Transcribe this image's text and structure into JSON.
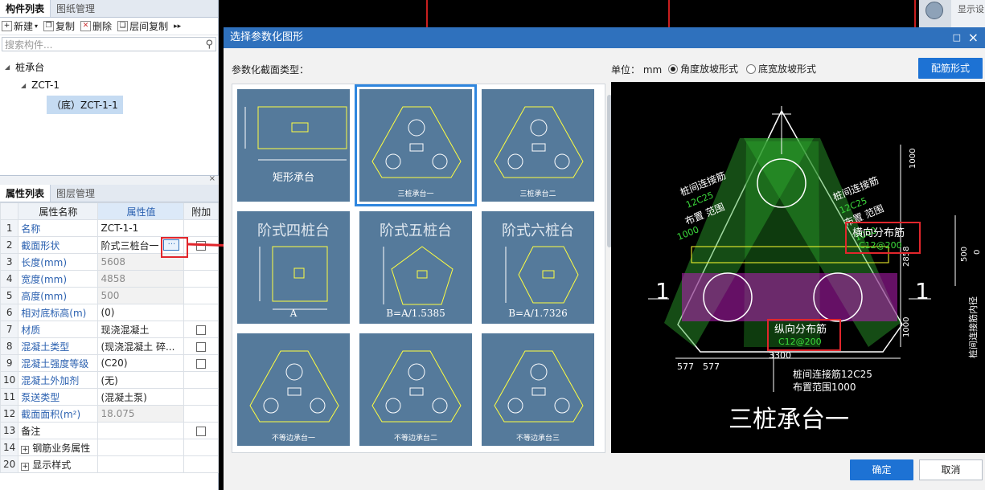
{
  "left_tabs": [
    "构件列表",
    "图纸管理"
  ],
  "toolbar": {
    "new": "新建",
    "copy": "复制",
    "delete": "删除",
    "floor_copy": "层间复制",
    "more": "▸▸"
  },
  "search_placeholder": "搜索构件...",
  "tree": {
    "root": "桩承台",
    "child": "ZCT-1",
    "leaf": "（底）ZCT-1-1"
  },
  "prop_tabs": [
    "属性列表",
    "图层管理"
  ],
  "props_header": {
    "name": "属性名称",
    "value": "属性值",
    "extra": "附加"
  },
  "props": [
    {
      "n": "1",
      "name": "名称",
      "value": "ZCT-1-1",
      "blue": true,
      "cb": false,
      "grey": false
    },
    {
      "n": "2",
      "name": "截面形状",
      "value": "阶式三桩台一",
      "blue": true,
      "cb": true,
      "grey": false
    },
    {
      "n": "3",
      "name": "长度(mm)",
      "value": "5608",
      "blue": true,
      "cb": false,
      "grey": true
    },
    {
      "n": "4",
      "name": "宽度(mm)",
      "value": "4858",
      "blue": true,
      "cb": false,
      "grey": true
    },
    {
      "n": "5",
      "name": "高度(mm)",
      "value": "500",
      "blue": true,
      "cb": false,
      "grey": true
    },
    {
      "n": "6",
      "name": "相对底标高(m)",
      "value": "(0)",
      "blue": true,
      "cb": false,
      "grey": false
    },
    {
      "n": "7",
      "name": "材质",
      "value": "现浇混凝土",
      "blue": true,
      "cb": true,
      "grey": false
    },
    {
      "n": "8",
      "name": "混凝土类型",
      "value": "(现浇混凝土  碎...",
      "blue": true,
      "cb": true,
      "grey": false
    },
    {
      "n": "9",
      "name": "混凝土强度等级",
      "value": "(C20)",
      "blue": true,
      "cb": true,
      "grey": false
    },
    {
      "n": "10",
      "name": "混凝土外加剂",
      "value": "(无)",
      "blue": true,
      "cb": false,
      "grey": false
    },
    {
      "n": "11",
      "name": "泵送类型",
      "value": "(混凝土泵)",
      "blue": true,
      "cb": false,
      "grey": false
    },
    {
      "n": "12",
      "name": "截面面积(m²)",
      "value": "18.075",
      "blue": true,
      "cb": false,
      "grey": true
    },
    {
      "n": "13",
      "name": "备注",
      "value": "",
      "blue": false,
      "cb": true,
      "grey": false
    },
    {
      "n": "14",
      "name": "钢筋业务属性",
      "value": "",
      "blue": false,
      "cb": false,
      "grey": false,
      "expand": true
    },
    {
      "n": "20",
      "name": "显示样式",
      "value": "",
      "blue": false,
      "cb": false,
      "grey": false,
      "expand": true
    }
  ],
  "dialog": {
    "title": "选择参数化图形",
    "section_label": "参数化截面类型：",
    "unit_label": "单位：  mm",
    "radio1": "角度放坡形式",
    "radio2": "底宽放坡形式",
    "rebar_button": "配筋形式",
    "ok": "确定",
    "cancel": "取消"
  },
  "shapes": [
    {
      "label": "矩形承台",
      "big": false
    },
    {
      "label": "三桩承台一",
      "big": false
    },
    {
      "label": "三桩承台二",
      "big": false
    },
    {
      "label": "阶式四桩台",
      "sub": "A",
      "big": true
    },
    {
      "label": "阶式五桩台",
      "sub": "B=A/1.5385",
      "big": true
    },
    {
      "label": "阶式六桩台",
      "sub": "B=A/1.7326",
      "big": true
    },
    {
      "label": "不等边承台一",
      "big": false
    },
    {
      "label": "不等边承台二",
      "big": false
    },
    {
      "label": "不等边承台三",
      "big": false
    }
  ],
  "preview": {
    "title": "三桩承台一",
    "rebar_h_title": "横向分布筋",
    "rebar_h_val": "C12@200",
    "rebar_v_title": "纵向分布筋",
    "rebar_v_val": "C12@200",
    "conn1": "桩间连接筋",
    "conn1_val": "12C25",
    "conn1_range": "布置 范围",
    "conn1_range_val": "1000",
    "conn2": "桩间连接筋",
    "conn2_val": "12C25",
    "conn2_range": "布置 范围",
    "conn2_range_val": "1000",
    "conn3": "桩间连接筋12C25",
    "conn3_range": "布置范围1000",
    "dim_top": "1000",
    "dim_mid": "2858",
    "dim_bot": "1000",
    "dim_width": "3300",
    "dim_l1": "577",
    "dim_l2": "577",
    "section_mark": "1",
    "side_dim": "500",
    "side_zero": "0",
    "side_text": "桩间连接筋内径"
  },
  "background_right": {
    "display_setting": "显示设"
  }
}
